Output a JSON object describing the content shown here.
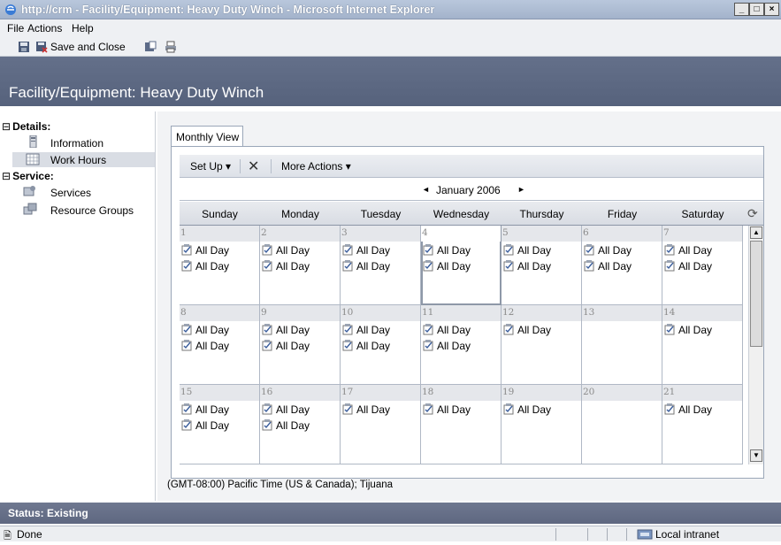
{
  "window": {
    "title": "http://crm - Facility/Equipment: Heavy Duty Winch - Microsoft Internet Explorer",
    "minimize": "_",
    "maximize": "□",
    "close": "×"
  },
  "menu": {
    "items": [
      "File",
      "Actions",
      "Help"
    ]
  },
  "toolbar": {
    "save_close_label": "Save and Close"
  },
  "header": {
    "title": "Facility/Equipment: Heavy Duty Winch"
  },
  "nav": {
    "sections": [
      {
        "label": "Details:",
        "toggle": "⊟",
        "items": [
          "Information",
          "Work Hours"
        ]
      },
      {
        "label": "Service:",
        "toggle": "⊟",
        "items": [
          "Services",
          "Resource Groups"
        ]
      }
    ],
    "selected": "Work Hours"
  },
  "tab": {
    "label": "Monthly View"
  },
  "cal_toolbar": {
    "setup_label": "Set Up ▾",
    "delete_glyph": "✕",
    "more_actions_label": "More Actions ▾"
  },
  "calendar": {
    "month_label": "January 2006",
    "prev": "◄",
    "next": "►",
    "days_of_week": [
      "Sunday",
      "Monday",
      "Tuesday",
      "Wednesday",
      "Thursday",
      "Friday",
      "Saturday"
    ],
    "weeks": [
      [
        {
          "d": "1",
          "events": [
            "All Day",
            "All Day"
          ]
        },
        {
          "d": "2",
          "events": [
            "All Day",
            "All Day"
          ]
        },
        {
          "d": "3",
          "events": [
            "All Day",
            "All Day"
          ]
        },
        {
          "d": "4",
          "events": [
            "All Day",
            "All Day"
          ],
          "today": true
        },
        {
          "d": "5",
          "events": [
            "All Day",
            "All Day"
          ]
        },
        {
          "d": "6",
          "events": [
            "All Day",
            "All Day"
          ]
        },
        {
          "d": "7",
          "events": [
            "All Day",
            "All Day"
          ]
        }
      ],
      [
        {
          "d": "8",
          "events": [
            "All Day",
            "All Day"
          ]
        },
        {
          "d": "9",
          "events": [
            "All Day",
            "All Day"
          ]
        },
        {
          "d": "10",
          "events": [
            "All Day",
            "All Day"
          ]
        },
        {
          "d": "11",
          "events": [
            "All Day",
            "All Day"
          ]
        },
        {
          "d": "12",
          "events": [
            "All Day"
          ]
        },
        {
          "d": "13",
          "events": []
        },
        {
          "d": "14",
          "events": [
            "All Day"
          ]
        }
      ],
      [
        {
          "d": "15",
          "events": [
            "All Day",
            "All Day"
          ]
        },
        {
          "d": "16",
          "events": [
            "All Day",
            "All Day"
          ]
        },
        {
          "d": "17",
          "events": [
            "All Day"
          ]
        },
        {
          "d": "18",
          "events": [
            "All Day"
          ]
        },
        {
          "d": "19",
          "events": [
            "All Day"
          ]
        },
        {
          "d": "20",
          "events": []
        },
        {
          "d": "21",
          "events": [
            "All Day"
          ]
        }
      ]
    ]
  },
  "timezone": "(GMT-08:00) Pacific Time (US & Canada); Tijuana",
  "status": {
    "label": "Status: Existing"
  },
  "ie_status": {
    "left": "Done",
    "zone": "Local intranet"
  },
  "colors": {
    "header_bg": "#5d6983",
    "status_bg": "#666f88",
    "accent": "#9aa6b8"
  }
}
